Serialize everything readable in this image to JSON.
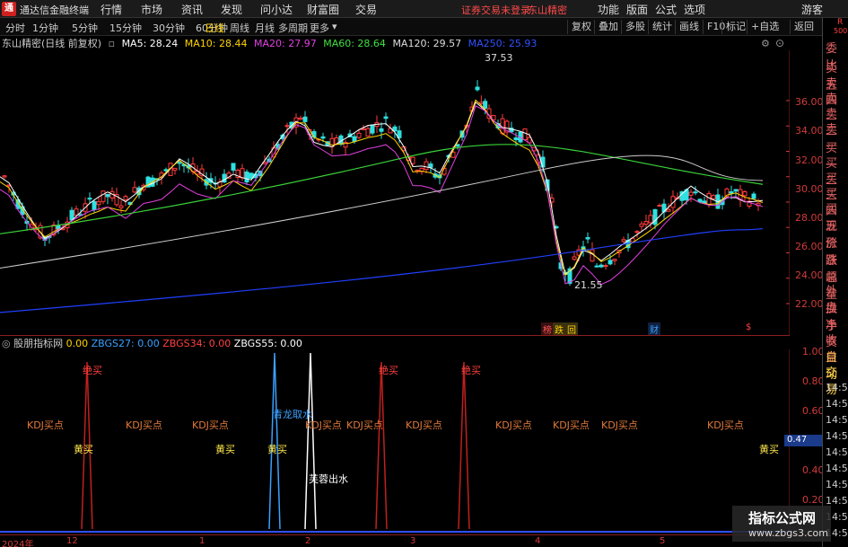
{
  "menubar": {
    "app_name": "通达信金融终端",
    "menus": [
      "行情",
      "市场",
      "资讯",
      "发现",
      "问小达",
      "财富圈",
      "交易"
    ],
    "notice": "证券交易未登录",
    "stock_name": "东山精密",
    "right_menus": [
      "功能",
      "版面",
      "公式",
      "选项"
    ],
    "user": "游客"
  },
  "toolbar": {
    "tabs": [
      "分时",
      "1分钟",
      "5分钟",
      "15分钟",
      "30分钟",
      "60分钟",
      "日线",
      "周线",
      "月线",
      "多周期",
      "更多"
    ],
    "active_tab": "日线",
    "right_buttons": [
      "复权",
      "叠加",
      "多股",
      "统计",
      "画线",
      "F10",
      "标记",
      "+自选",
      "返回"
    ]
  },
  "legend": {
    "title": "东山精密(日线 前复权)",
    "ma": [
      {
        "label": "MA5: 28.24",
        "color": "#ffffff"
      },
      {
        "label": "MA10: 28.44",
        "color": "#ffd200"
      },
      {
        "label": "MA20: 27.97",
        "color": "#e040e0"
      },
      {
        "label": "MA60: 28.64",
        "color": "#40e040"
      },
      {
        "label": "MA120: 29.57",
        "color": "#dddddd"
      },
      {
        "label": "MA250: 25.93",
        "color": "#3050ff"
      }
    ]
  },
  "price_axis": [
    "36.00",
    "34.00",
    "32.00",
    "30.00",
    "28.00",
    "26.00",
    "24.00",
    "22.00",
    "20.00"
  ],
  "annotations": {
    "high": "37.53",
    "low": "21.55"
  },
  "event_tags": [
    {
      "text": "榜",
      "color": "#ff5555"
    },
    {
      "text": "跌",
      "color": "#ffd200"
    },
    {
      "text": "回",
      "color": "#ffd200"
    },
    {
      "text": "财",
      "color": "#3aa0ff"
    },
    {
      "text": "$",
      "color": "#ff4040"
    }
  ],
  "sub_indicator": {
    "name": "股朋指标网",
    "values": [
      {
        "label": "0.00",
        "color": "#ffd200"
      },
      {
        "label": "ZBGS27: 0.00",
        "color": "#3aa0ff"
      },
      {
        "label": "ZBGS34: 0.00",
        "color": "#ff4040"
      },
      {
        "label": "ZBGS55: 0.00",
        "color": "#ffffff"
      }
    ],
    "axis": [
      "1.00",
      "0.80",
      "0.60",
      "0.40",
      "0.20"
    ],
    "current": "0.47"
  },
  "signals": {
    "jue_mai": "绝买",
    "kdj": "KDJ买点",
    "huang": "黄买",
    "qinglong": "青龙取水",
    "furong": "芙蓉出水"
  },
  "sidepanel": {
    "rb": "R",
    "num": "500",
    "items": [
      "委比",
      "卖五",
      "卖四",
      "卖三",
      "卖二",
      "卖一",
      "买一",
      "买二",
      "买三",
      "买四",
      "买五",
      "现价",
      "涨跌",
      "涨幅",
      "总量",
      "外盘",
      "换手",
      "净资",
      "收益"
    ],
    "auto_trade": [
      "自动",
      "交易"
    ],
    "times": [
      "14:5",
      "14:5",
      "14:5",
      "14:5",
      "14:5",
      "14:5",
      "14:5",
      "14:5",
      "14:5",
      "14:5"
    ]
  },
  "dates": {
    "year": "2024年",
    "months": [
      "12",
      "1",
      "2",
      "3",
      "4",
      "5"
    ]
  },
  "watermark": {
    "title": "指标公式网",
    "url": "www.zbgs3.com"
  }
}
